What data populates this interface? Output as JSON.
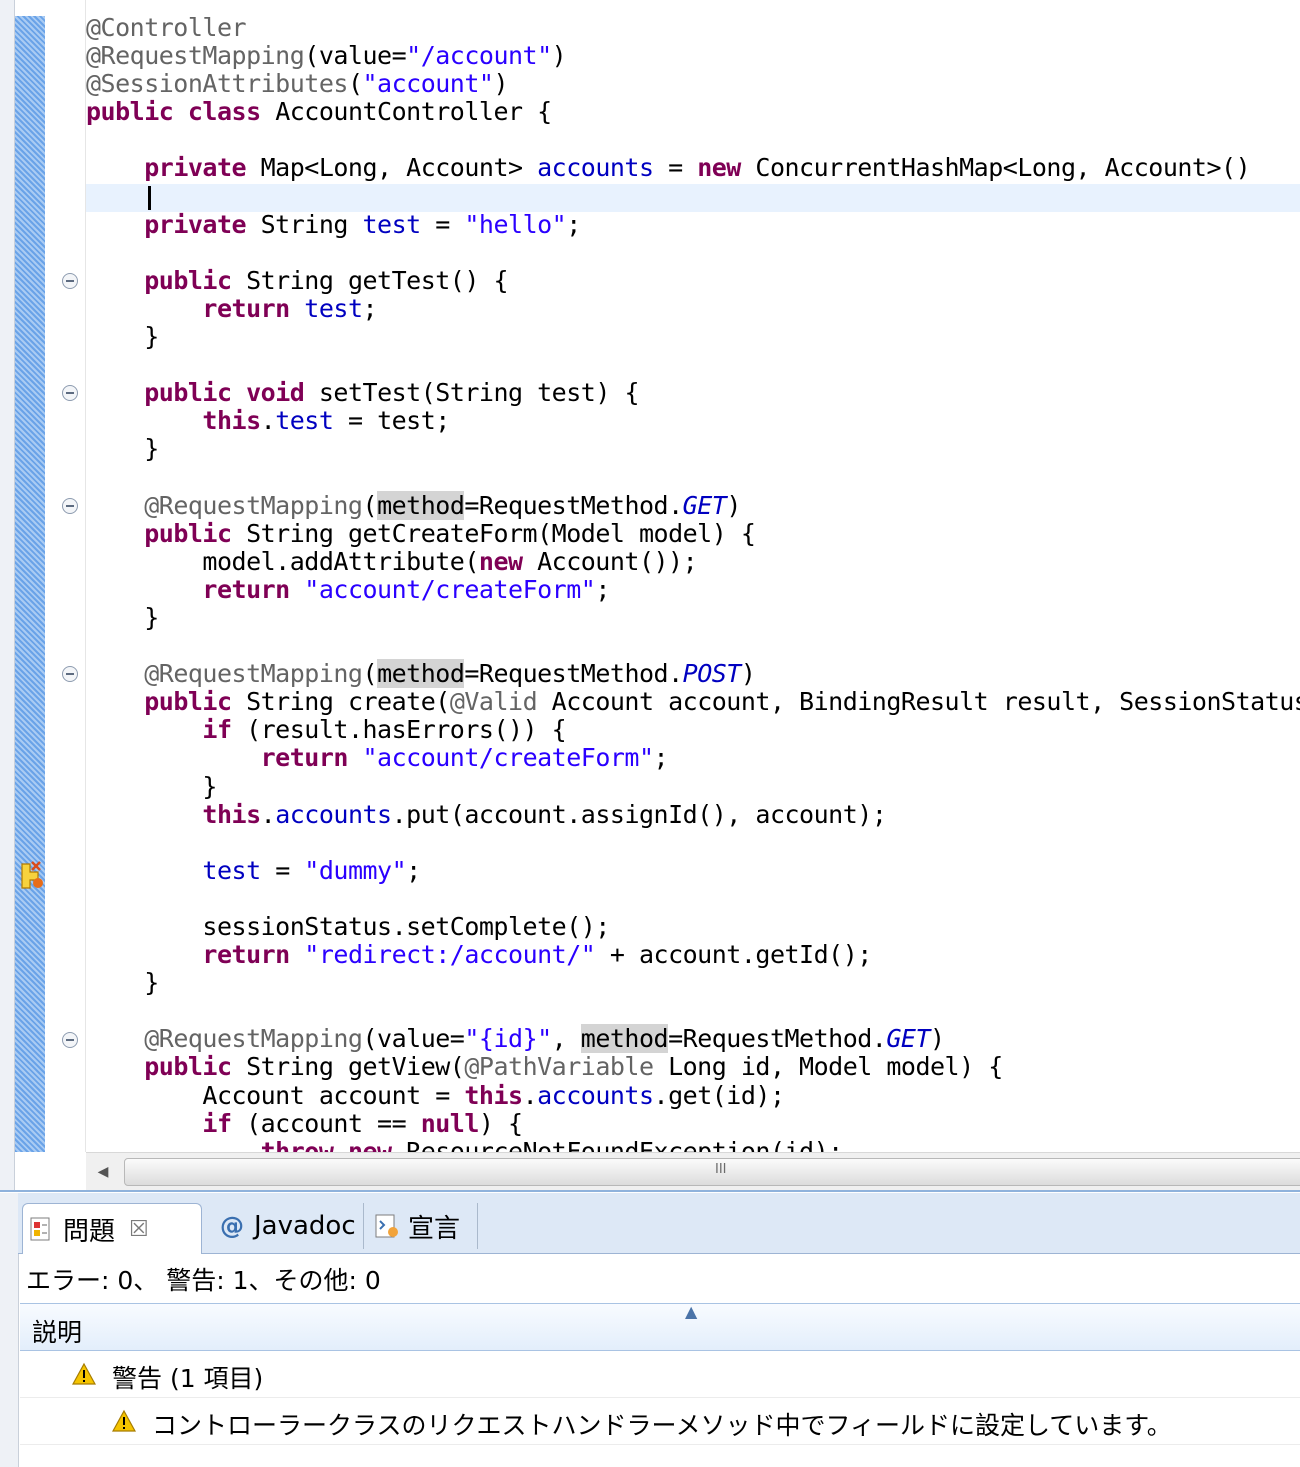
{
  "editor": {
    "lines": [
      [
        {
          "t": "@Controller",
          "c": "ann"
        }
      ],
      [
        {
          "t": "@RequestMapping",
          "c": "ann"
        },
        {
          "t": "(value="
        },
        {
          "t": "\"/account\"",
          "c": "str"
        },
        {
          "t": ")"
        }
      ],
      [
        {
          "t": "@SessionAttributes",
          "c": "ann"
        },
        {
          "t": "("
        },
        {
          "t": "\"account\"",
          "c": "str"
        },
        {
          "t": ")"
        }
      ],
      [
        {
          "t": "public",
          "c": "kw"
        },
        {
          "t": " "
        },
        {
          "t": "class",
          "c": "kw"
        },
        {
          "t": " AccountController {"
        }
      ],
      [],
      [
        {
          "t": "    "
        },
        {
          "t": "private",
          "c": "kw"
        },
        {
          "t": " Map<Long, Account> "
        },
        {
          "t": "accounts",
          "c": "fld"
        },
        {
          "t": " = "
        },
        {
          "t": "new",
          "c": "kw"
        },
        {
          "t": " ConcurrentHashMap<Long, Account>()"
        }
      ],
      [],
      [
        {
          "t": "    "
        },
        {
          "t": "private",
          "c": "kw"
        },
        {
          "t": " String "
        },
        {
          "t": "test",
          "c": "fld"
        },
        {
          "t": " = "
        },
        {
          "t": "\"hello\"",
          "c": "str"
        },
        {
          "t": ";"
        }
      ],
      [],
      [
        {
          "t": "    "
        },
        {
          "t": "public",
          "c": "kw"
        },
        {
          "t": " String getTest() {"
        }
      ],
      [
        {
          "t": "        "
        },
        {
          "t": "return",
          "c": "kw"
        },
        {
          "t": " "
        },
        {
          "t": "test",
          "c": "fld"
        },
        {
          "t": ";"
        }
      ],
      [
        {
          "t": "    }"
        }
      ],
      [],
      [
        {
          "t": "    "
        },
        {
          "t": "public",
          "c": "kw"
        },
        {
          "t": " "
        },
        {
          "t": "void",
          "c": "kw"
        },
        {
          "t": " setTest(String test) {"
        }
      ],
      [
        {
          "t": "        "
        },
        {
          "t": "this",
          "c": "kw"
        },
        {
          "t": "."
        },
        {
          "t": "test",
          "c": "fld"
        },
        {
          "t": " = test;"
        }
      ],
      [
        {
          "t": "    }"
        }
      ],
      [],
      [
        {
          "t": "    "
        },
        {
          "t": "@RequestMapping",
          "c": "ann"
        },
        {
          "t": "("
        },
        {
          "t": "method",
          "c": "occ"
        },
        {
          "t": "=RequestMethod."
        },
        {
          "t": "GET",
          "c": "cst"
        },
        {
          "t": ")"
        }
      ],
      [
        {
          "t": "    "
        },
        {
          "t": "public",
          "c": "kw"
        },
        {
          "t": " String getCreateForm(Model model) {"
        }
      ],
      [
        {
          "t": "        model.addAttribute("
        },
        {
          "t": "new",
          "c": "kw"
        },
        {
          "t": " Account());"
        }
      ],
      [
        {
          "t": "        "
        },
        {
          "t": "return",
          "c": "kw"
        },
        {
          "t": " "
        },
        {
          "t": "\"account/createForm\"",
          "c": "str"
        },
        {
          "t": ";"
        }
      ],
      [
        {
          "t": "    }"
        }
      ],
      [],
      [
        {
          "t": "    "
        },
        {
          "t": "@RequestMapping",
          "c": "ann"
        },
        {
          "t": "("
        },
        {
          "t": "method",
          "c": "occ"
        },
        {
          "t": "=RequestMethod."
        },
        {
          "t": "POST",
          "c": "cst"
        },
        {
          "t": ")"
        }
      ],
      [
        {
          "t": "    "
        },
        {
          "t": "public",
          "c": "kw"
        },
        {
          "t": " String create("
        },
        {
          "t": "@Valid",
          "c": "ann"
        },
        {
          "t": " Account account, BindingResult result, SessionStatus sessionStatus) {"
        }
      ],
      [
        {
          "t": "        "
        },
        {
          "t": "if",
          "c": "kw"
        },
        {
          "t": " (result.hasErrors()) {"
        }
      ],
      [
        {
          "t": "            "
        },
        {
          "t": "return",
          "c": "kw"
        },
        {
          "t": " "
        },
        {
          "t": "\"account/createForm\"",
          "c": "str"
        },
        {
          "t": ";"
        }
      ],
      [
        {
          "t": "        }"
        }
      ],
      [
        {
          "t": "        "
        },
        {
          "t": "this",
          "c": "kw"
        },
        {
          "t": "."
        },
        {
          "t": "accounts",
          "c": "fld"
        },
        {
          "t": ".put(account.assignId(), account);"
        }
      ],
      [],
      [
        {
          "t": "        "
        },
        {
          "t": "test",
          "c": "fld"
        },
        {
          "t": " = "
        },
        {
          "t": "\"dummy\"",
          "c": "str"
        },
        {
          "t": ";"
        }
      ],
      [],
      [
        {
          "t": "        sessionStatus.setComplete();"
        }
      ],
      [
        {
          "t": "        "
        },
        {
          "t": "return",
          "c": "kw"
        },
        {
          "t": " "
        },
        {
          "t": "\"redirect:/account/\"",
          "c": "str"
        },
        {
          "t": " + account.getId();"
        }
      ],
      [
        {
          "t": "    }"
        }
      ],
      [],
      [
        {
          "t": "    "
        },
        {
          "t": "@RequestMapping",
          "c": "ann"
        },
        {
          "t": "(value="
        },
        {
          "t": "\"{id}\"",
          "c": "str"
        },
        {
          "t": ", "
        },
        {
          "t": "method",
          "c": "occ"
        },
        {
          "t": "=RequestMethod."
        },
        {
          "t": "GET",
          "c": "cst"
        },
        {
          "t": ")"
        }
      ],
      [
        {
          "t": "    "
        },
        {
          "t": "public",
          "c": "kw"
        },
        {
          "t": " String getView("
        },
        {
          "t": "@PathVariable",
          "c": "ann"
        },
        {
          "t": " Long id, Model model) {"
        }
      ],
      [
        {
          "t": "        Account account = "
        },
        {
          "t": "this",
          "c": "kw"
        },
        {
          "t": "."
        },
        {
          "t": "accounts",
          "c": "fld"
        },
        {
          "t": ".get(id);"
        }
      ],
      [
        {
          "t": "        "
        },
        {
          "t": "if",
          "c": "kw"
        },
        {
          "t": " (account == "
        },
        {
          "t": "null",
          "c": "kw"
        },
        {
          "t": ") {"
        }
      ],
      [
        {
          "t": "            "
        },
        {
          "t": "throw",
          "c": "kw"
        },
        {
          "t": " "
        },
        {
          "t": "new",
          "c": "kw"
        },
        {
          "t": " ResourceNotFoundException(id);"
        }
      ]
    ],
    "fold_lines": [
      9,
      13,
      17,
      23,
      36
    ],
    "warning_line": 30,
    "scroll_grip": "III"
  },
  "problems_view": {
    "tabs": [
      {
        "label": "問題",
        "icon": "problems-icon",
        "active": true
      },
      {
        "label": "Javadoc",
        "icon": "javadoc-at-icon",
        "active": false
      },
      {
        "label": "宣言",
        "icon": "declaration-icon",
        "active": false
      }
    ],
    "close_glyph": "☒",
    "summary": "エラー: 0、 警告: 1、その他: 0",
    "column_header": "説明",
    "group_label": "警告 (1 項目)",
    "item_label": "コントローラークラスのリクエストハンドラーメソッド中でフィールドに設定しています。",
    "colors": {
      "warning": "#f5c400",
      "keyword": "#7f0055",
      "string": "#2a00ff",
      "field": "#0000c0"
    }
  }
}
